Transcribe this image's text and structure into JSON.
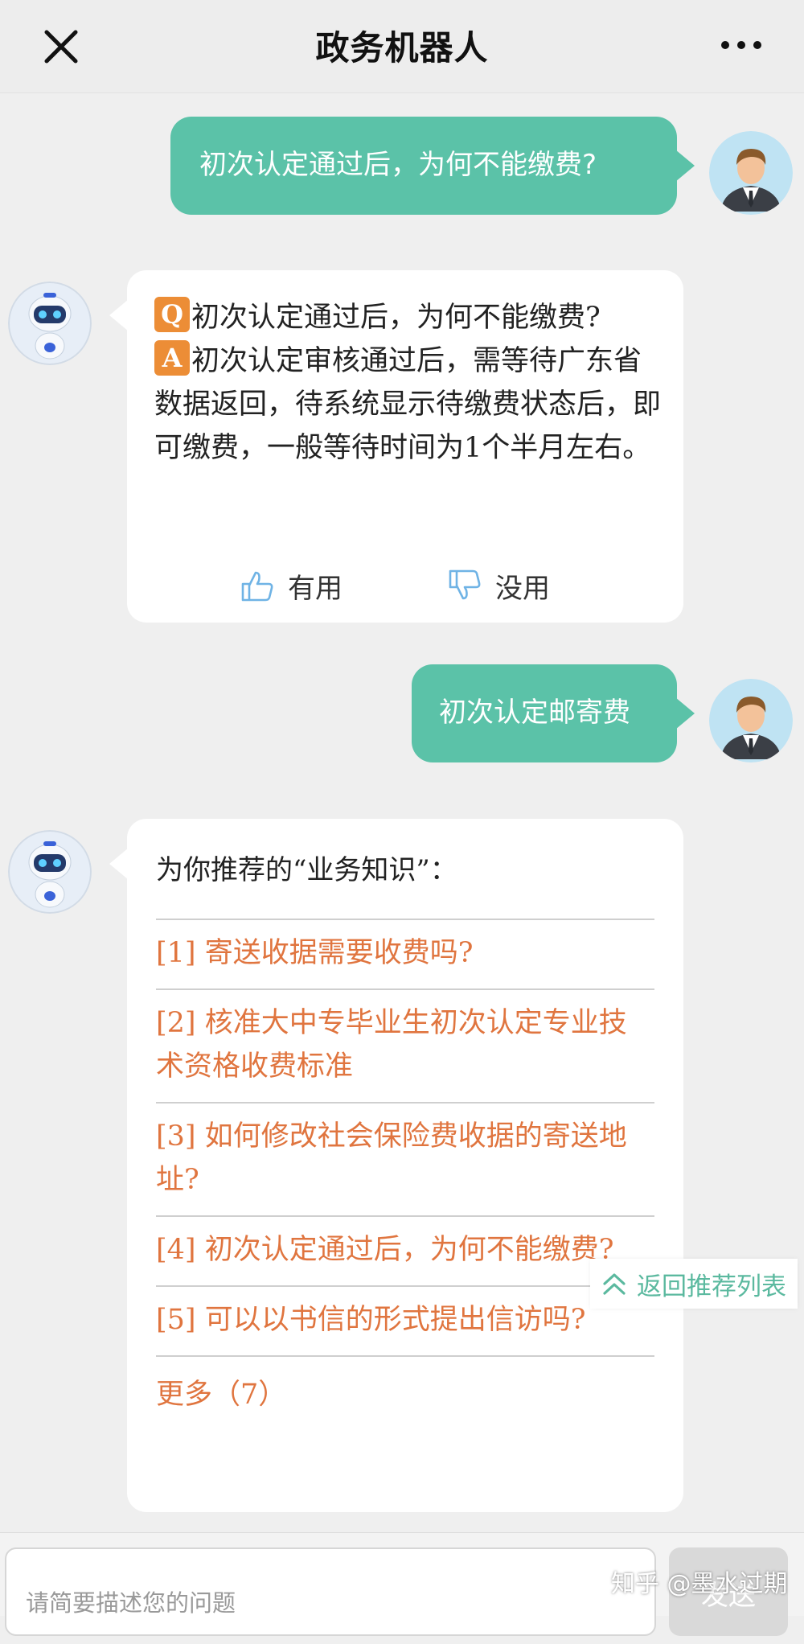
{
  "header": {
    "title": "政务机器人"
  },
  "messages": {
    "user1": "初次认定通过后，为何不能缴费?",
    "bot1": {
      "q_tag": "Q",
      "question": "初次认定通过后，为何不能缴费?",
      "a_tag": "A",
      "answer": "初次认定审核通过后，需等待广东省数据返回，待系统显示待缴费状态后，即可缴费，一般等待时间为1个半月左右。",
      "useful_label": "有用",
      "useless_label": "没用"
    },
    "user2": "初次认定邮寄费",
    "bot2": {
      "title": "为你推荐的“业务知识”：",
      "items": [
        "[1] 寄送收据需要收费吗?",
        "[2] 核准大中专毕业生初次认定专业技术资格收费标准",
        "[3] 如何修改社会保险费收据的寄送地址?",
        "[4] 初次认定通过后，为何不能缴费?",
        "[5] 可以以书信的形式提出信访吗?"
      ],
      "more_label": "更多（7）"
    }
  },
  "back_to_list_label": "返回推荐列表",
  "input": {
    "placeholder": "请简要描述您的问题"
  },
  "send_label": "发送",
  "watermark": "知乎 @墨水过期",
  "colors": {
    "accent_green": "#5bc2a8",
    "link_orange": "#e0753f",
    "tag_orange": "#ec8d36"
  },
  "icons": [
    "close-icon",
    "more-icon",
    "user-avatar",
    "robot-avatar",
    "thumbs-up-icon",
    "thumbs-down-icon",
    "chevron-up-icon"
  ]
}
